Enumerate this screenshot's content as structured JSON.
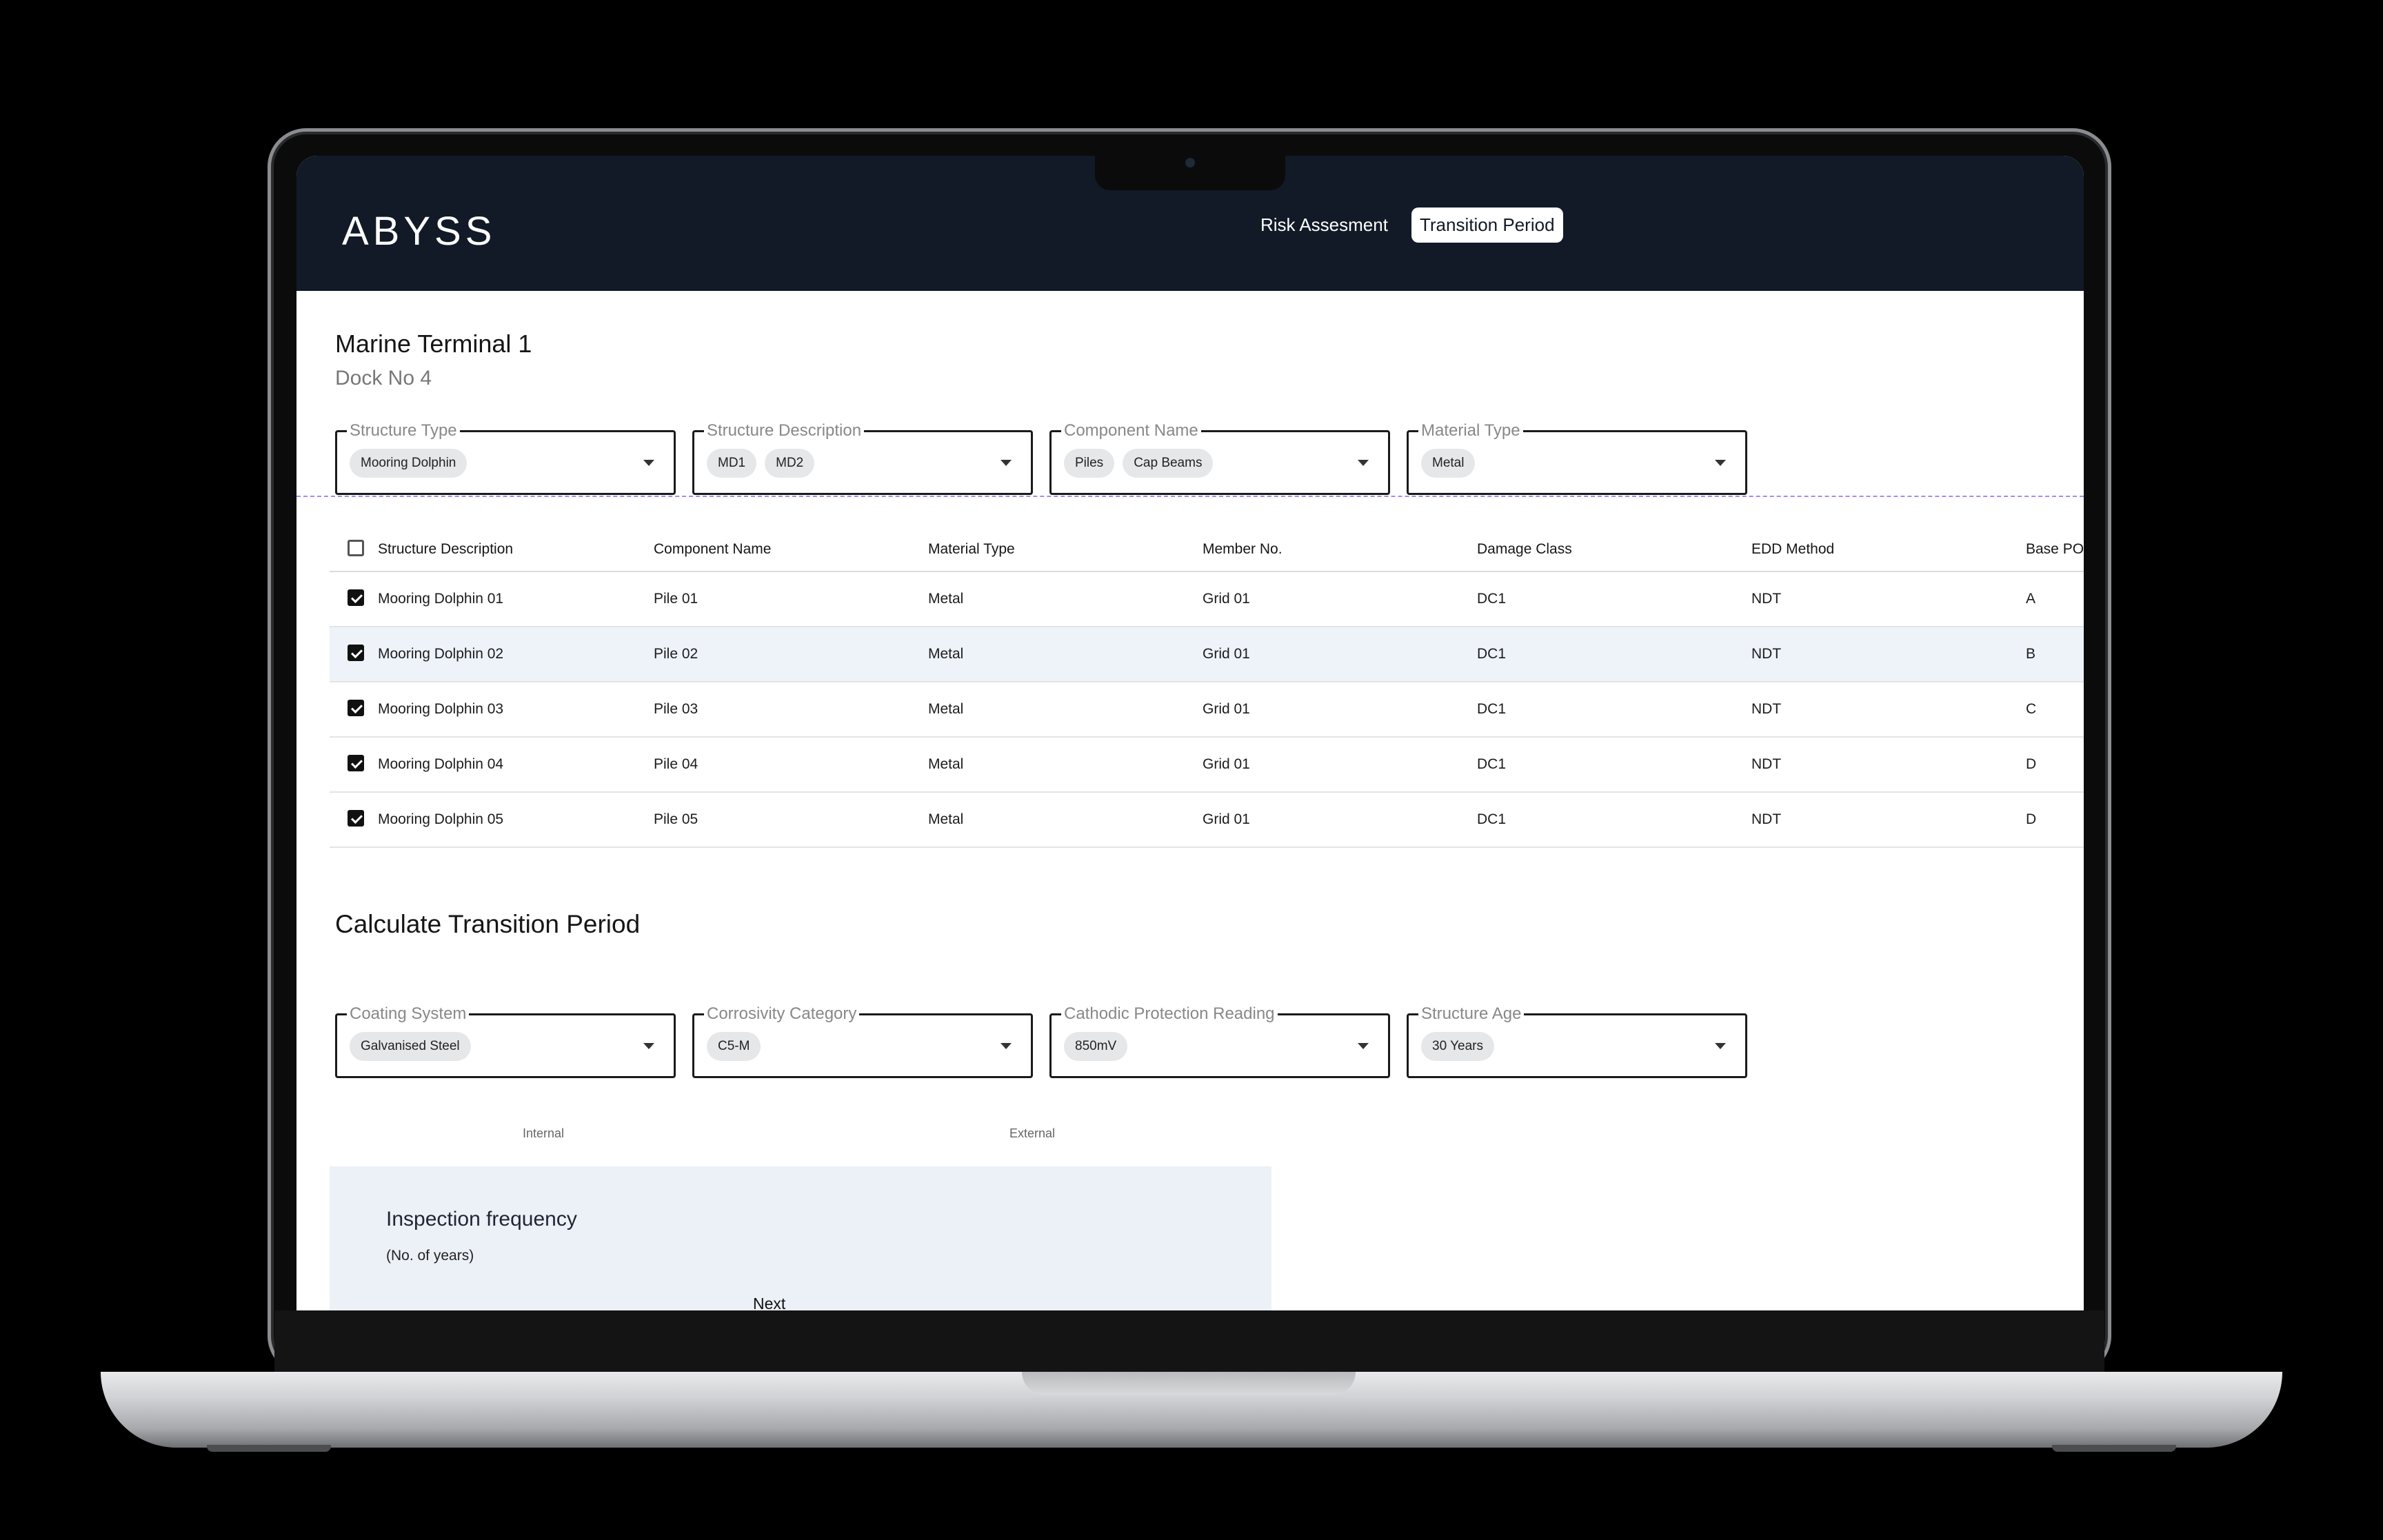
{
  "app": {
    "logo": "ABYSS"
  },
  "nav": {
    "items": [
      {
        "label": "Risk Assesment",
        "active": false
      },
      {
        "label": "Transition Period",
        "active": true
      }
    ]
  },
  "page": {
    "title": "Marine Terminal 1",
    "subtitle": "Dock No 4"
  },
  "filters": [
    {
      "label": "Structure Type",
      "chips": [
        "Mooring Dolphin"
      ]
    },
    {
      "label": "Structure Description",
      "chips": [
        "MD1",
        "MD2"
      ]
    },
    {
      "label": "Component Name",
      "chips": [
        "Piles",
        "Cap Beams"
      ]
    },
    {
      "label": "Material Type",
      "chips": [
        "Metal"
      ]
    }
  ],
  "table": {
    "columns": [
      "Structure Description",
      "Component Name",
      "Material Type",
      "Member No.",
      "Damage Class",
      "EDD Method",
      "Base POF"
    ],
    "rows": [
      {
        "checked": true,
        "cells": [
          "Mooring Dolphin 01",
          "Pile 01",
          "Metal",
          "Grid 01",
          "DC1",
          "NDT",
          "A"
        ]
      },
      {
        "checked": true,
        "cells": [
          "Mooring Dolphin 02",
          "Pile 02",
          "Metal",
          "Grid 01",
          "DC1",
          "NDT",
          "B"
        ]
      },
      {
        "checked": true,
        "cells": [
          "Mooring Dolphin 03",
          "Pile 03",
          "Metal",
          "Grid 01",
          "DC1",
          "NDT",
          "C"
        ]
      },
      {
        "checked": true,
        "cells": [
          "Mooring Dolphin 04",
          "Pile 04",
          "Metal",
          "Grid 01",
          "DC1",
          "NDT",
          "D"
        ]
      },
      {
        "checked": true,
        "cells": [
          "Mooring Dolphin 05",
          "Pile 05",
          "Metal",
          "Grid 01",
          "DC1",
          "NDT",
          "D"
        ]
      }
    ]
  },
  "calc": {
    "title": "Calculate Transition Period",
    "fields": [
      {
        "label": "Coating System",
        "chips": [
          "Galvanised Steel"
        ]
      },
      {
        "label": "Corrosivity Category",
        "chips": [
          "C5-M"
        ]
      },
      {
        "label": "Cathodic Protection Reading",
        "chips": [
          "850mV"
        ]
      },
      {
        "label": "Structure Age",
        "chips": [
          "30 Years"
        ]
      }
    ],
    "tabs": [
      "Internal",
      "External"
    ]
  },
  "inspection": {
    "title": "Inspection frequency",
    "subtitle": "(No. of years)",
    "next_label": "Next"
  },
  "colors": {
    "header_bg": "#111a26",
    "highlight_row": "#eef3fa",
    "card_bg": "#ecf0f7",
    "dashed_line": "#a889f0"
  }
}
